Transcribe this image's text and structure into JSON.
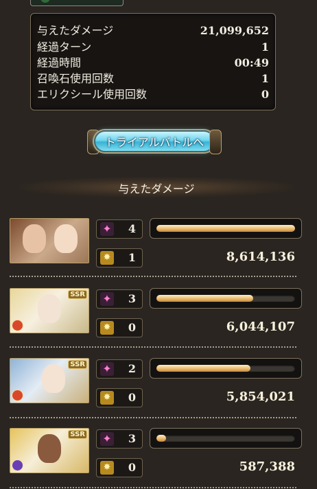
{
  "stats": {
    "rows": [
      {
        "label": "与えたダメージ",
        "value": "21,099,652"
      },
      {
        "label": "経過ターン",
        "value": "1"
      },
      {
        "label": "経過時間",
        "value": "00:49"
      },
      {
        "label": "召喚石使用回数",
        "value": "1"
      },
      {
        "label": "エリクシール使用回数",
        "value": "0"
      }
    ]
  },
  "trial_button": {
    "label": "トライアルバトルへ"
  },
  "damage_section": {
    "title": "与えたダメージ"
  },
  "characters": [
    {
      "crit_count": "4",
      "ougi_count": "1",
      "damage": "8,614,136",
      "bar_ratio": 1.0,
      "rarity": "",
      "element": ""
    },
    {
      "crit_count": "3",
      "ougi_count": "0",
      "damage": "6,044,107",
      "bar_ratio": 0.7,
      "rarity": "SSR",
      "element": "fire"
    },
    {
      "crit_count": "2",
      "ougi_count": "0",
      "damage": "5,854,021",
      "bar_ratio": 0.68,
      "rarity": "SSR",
      "element": "fire"
    },
    {
      "crit_count": "3",
      "ougi_count": "0",
      "damage": "587,388",
      "bar_ratio": 0.07,
      "rarity": "SSR",
      "element": "dark"
    }
  ],
  "icons": {
    "crit": "pink-sparkle-icon",
    "ougi": "ougi-burst-icon"
  },
  "colors": {
    "bar_fill": "#e7b56a",
    "panel_border": "#7c715c",
    "fire": "#d9482a",
    "dark": "#6a3fb5",
    "button": "#6fd6ee"
  }
}
